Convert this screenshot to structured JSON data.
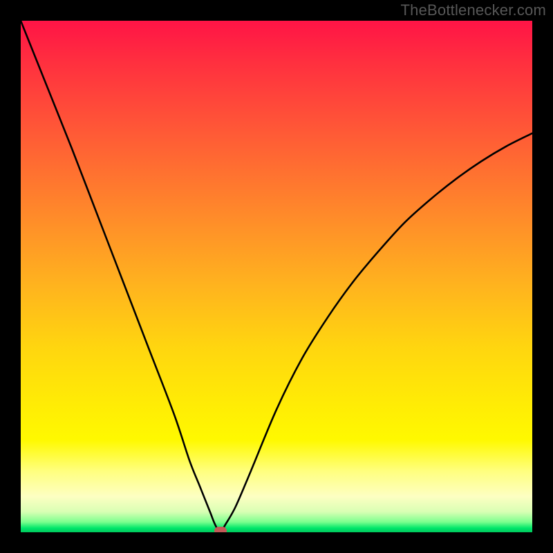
{
  "attribution": "TheBottlenecker.com",
  "colors": {
    "curve_stroke": "#000000",
    "marker_fill": "#c35a58",
    "frame_background": "#000000"
  },
  "chart_data": {
    "type": "line",
    "title": "",
    "xlabel": "",
    "ylabel": "",
    "xlim": [
      0,
      100
    ],
    "ylim": [
      0,
      100
    ],
    "annotations": [
      {
        "type": "marker",
        "x": 39,
        "y": 0,
        "shape": "rounded-rect",
        "color": "#c35a58"
      }
    ],
    "series": [
      {
        "name": "bottleneck-curve",
        "x": [
          0,
          5,
          10,
          15,
          20,
          25,
          30,
          33,
          35,
          37,
          38,
          39,
          40,
          42,
          45,
          50,
          55,
          60,
          65,
          70,
          75,
          80,
          85,
          90,
          95,
          100
        ],
        "values": [
          100,
          87.5,
          75,
          62,
          49,
          36,
          23,
          14,
          9,
          4,
          1.5,
          0,
          1.5,
          5,
          12,
          24,
          34,
          42,
          49,
          55,
          60.5,
          65,
          69,
          72.5,
          75.5,
          78
        ]
      }
    ],
    "background_gradient": {
      "direction": "vertical",
      "stops": [
        {
          "pos": 0.0,
          "color": "#ff1446"
        },
        {
          "pos": 0.08,
          "color": "#ff2f3f"
        },
        {
          "pos": 0.22,
          "color": "#ff5a36"
        },
        {
          "pos": 0.38,
          "color": "#ff8a2a"
        },
        {
          "pos": 0.52,
          "color": "#ffb41e"
        },
        {
          "pos": 0.64,
          "color": "#ffd60f"
        },
        {
          "pos": 0.74,
          "color": "#ffea06"
        },
        {
          "pos": 0.82,
          "color": "#fff900"
        },
        {
          "pos": 0.88,
          "color": "#ffff7e"
        },
        {
          "pos": 0.93,
          "color": "#fdffc2"
        },
        {
          "pos": 0.96,
          "color": "#d9ffb4"
        },
        {
          "pos": 0.98,
          "color": "#7cff8e"
        },
        {
          "pos": 0.992,
          "color": "#00e66a"
        },
        {
          "pos": 1.0,
          "color": "#00c95d"
        }
      ]
    }
  }
}
